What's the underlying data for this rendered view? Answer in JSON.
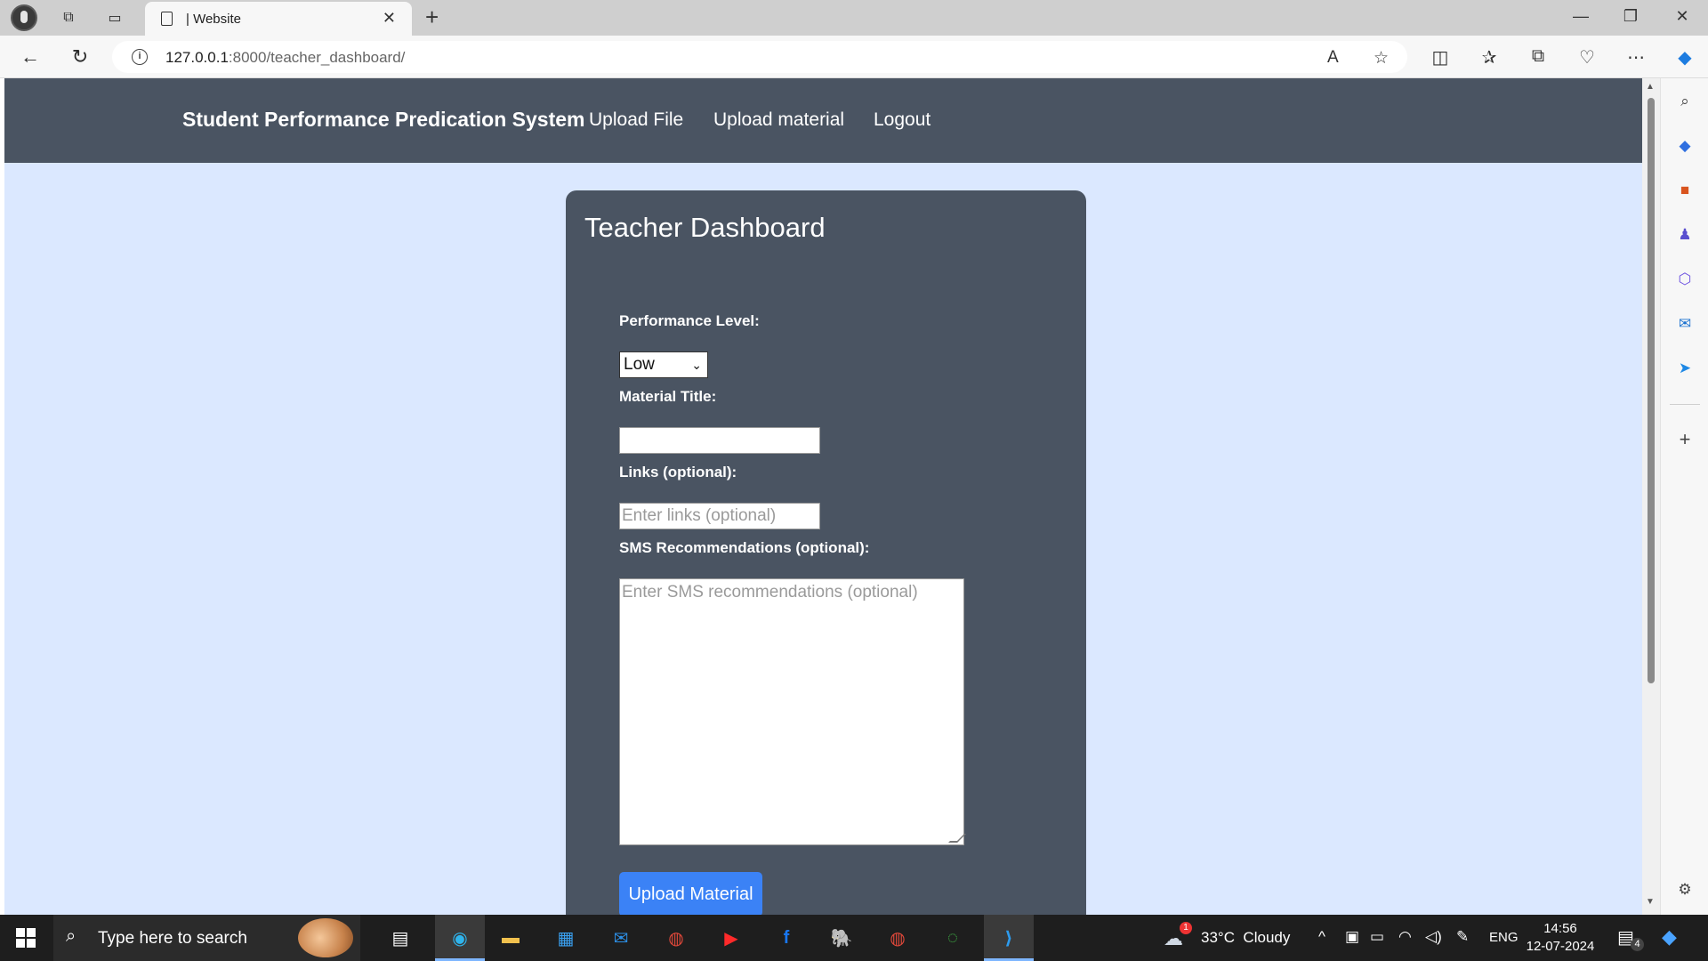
{
  "browser": {
    "tab_title": "| Website",
    "url_host": "127.0.0.1",
    "url_rest": ":8000/teacher_dashboard/"
  },
  "site": {
    "brand": "Student Performance Predication System",
    "nav": [
      "Upload File",
      "Upload material",
      "Logout"
    ]
  },
  "dashboard": {
    "title": "Teacher Dashboard",
    "performance_label": "Performance Level:",
    "performance_value": "Low",
    "material_title_label": "Material Title:",
    "material_title_value": "",
    "links_label": "Links (optional):",
    "links_placeholder": "Enter links (optional)",
    "sms_label": "SMS Recommendations (optional):",
    "sms_placeholder": "Enter SMS recommendations (optional)",
    "submit_label": "Upload Material"
  },
  "taskbar": {
    "search_placeholder": "Type here to search",
    "weather": "33°C  Cloudy",
    "weather_badge": "1",
    "language": "ENG",
    "time": "14:56",
    "date": "12-07-2024",
    "notification_count": "4"
  }
}
